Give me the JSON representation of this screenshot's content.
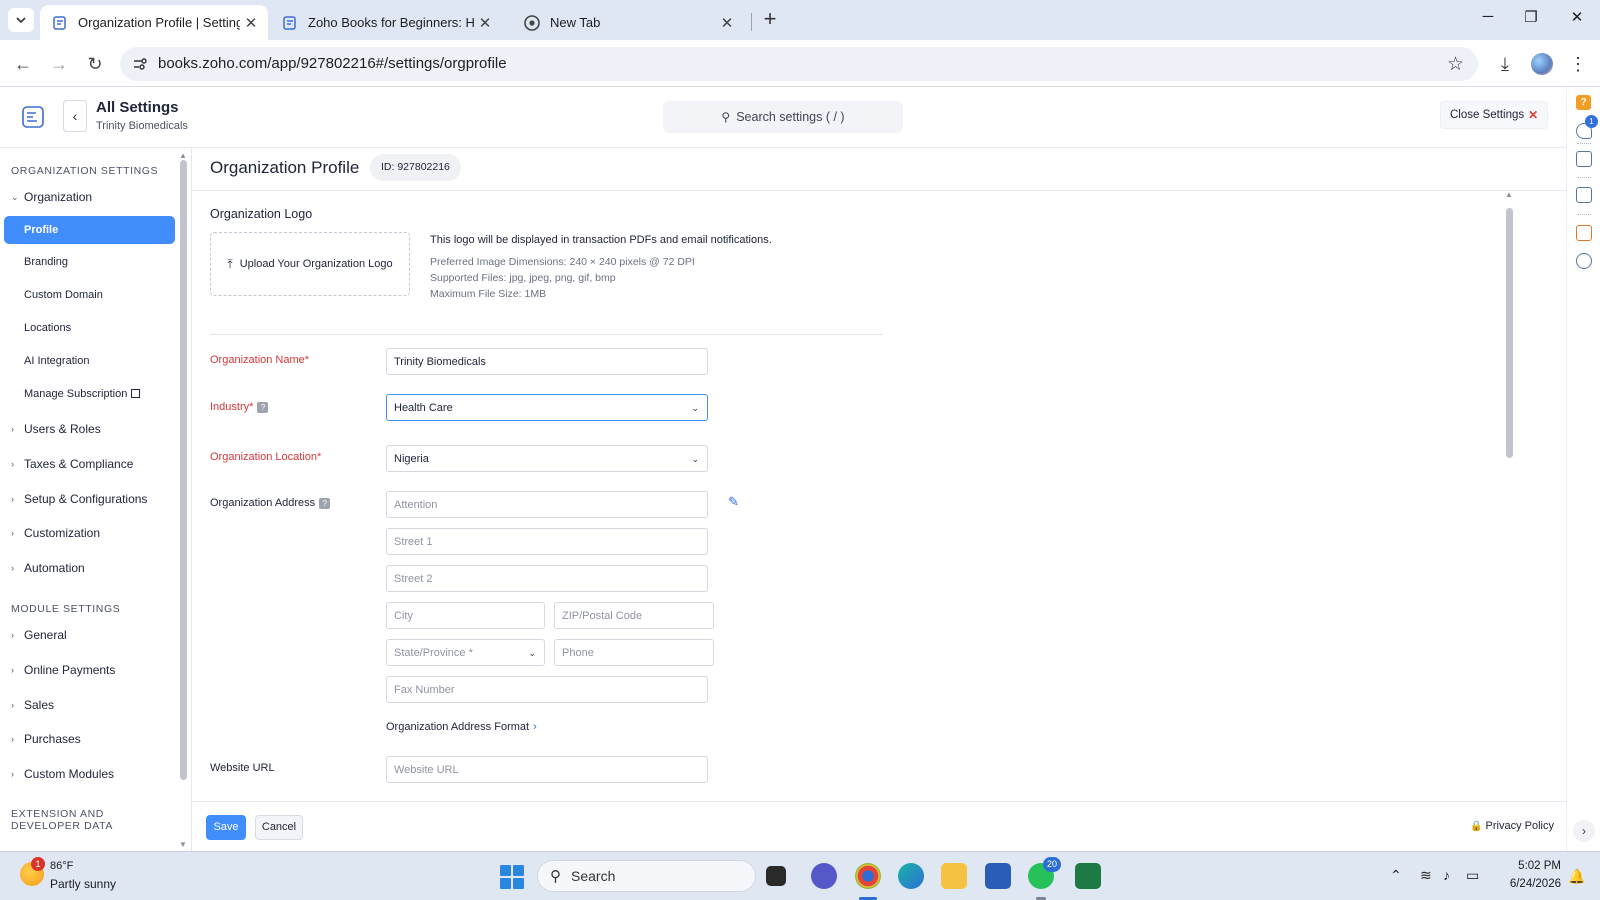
{
  "browser": {
    "tabs": [
      {
        "title": "Organization Profile | Settings |",
        "active": true
      },
      {
        "title": "Zoho Books for Beginners: How",
        "active": false
      },
      {
        "title": "New Tab",
        "active": false
      }
    ],
    "url": "books.zoho.com/app/927802216#/settings/orgprofile"
  },
  "header": {
    "title": "All Settings",
    "subtitle": "Trinity Biomedicals",
    "search_placeholder": "Search settings ( / )",
    "close_label": "Close Settings"
  },
  "rail": {
    "notification_count": "1"
  },
  "sidebar": {
    "org_section": "ORGANIZATION SETTINGS",
    "org_group": "Organization",
    "org_items": [
      "Profile",
      "Branding",
      "Custom Domain",
      "Locations",
      "AI Integration",
      "Manage Subscription"
    ],
    "org_groups": [
      "Users & Roles",
      "Taxes & Compliance",
      "Setup & Configurations",
      "Customization",
      "Automation"
    ],
    "module_section": "MODULE SETTINGS",
    "module_groups": [
      "General",
      "Online Payments",
      "Sales",
      "Purchases",
      "Custom Modules"
    ],
    "ext_section_line1": "EXTENSION AND",
    "ext_section_line2": "DEVELOPER DATA"
  },
  "page": {
    "title": "Organization Profile",
    "id_badge": "ID: 927802216",
    "logo_label": "Organization Logo",
    "upload_label": "Upload Your Organization Logo",
    "logo_help": [
      "This logo will be displayed in transaction PDFs and email notifications.",
      "Preferred Image Dimensions: 240 × 240 pixels @ 72 DPI",
      "Supported Files: jpg, jpeg, png, gif, bmp",
      "Maximum File Size: 1MB"
    ],
    "fields": {
      "org_name_label": "Organization Name*",
      "org_name_value": "Trinity Biomedicals",
      "industry_label": "Industry*",
      "industry_value": "Health Care",
      "location_label": "Organization Location*",
      "location_value": "Nigeria",
      "address_label": "Organization Address",
      "attention_ph": "Attention",
      "street1_ph": "Street 1",
      "street2_ph": "Street 2",
      "city_ph": "City",
      "zip_ph": "ZIP/Postal Code",
      "state_ph": "State/Province *",
      "phone_ph": "Phone",
      "fax_ph": "Fax Number",
      "address_format": "Organization Address Format",
      "website_label": "Website URL",
      "website_ph": "Website URL"
    },
    "save_label": "Save",
    "cancel_label": "Cancel",
    "privacy_label": "Privacy Policy"
  },
  "taskbar": {
    "weather_temp": "86°F",
    "weather_desc": "Partly sunny",
    "weather_badge": "1",
    "search_label": "Search",
    "whatsapp_badge": "20",
    "time": "5:02 PM",
    "date": "6/24/2026"
  },
  "colors": {
    "accent": "#408dfb",
    "required": "#d6373a",
    "warning": "#f29d24"
  }
}
